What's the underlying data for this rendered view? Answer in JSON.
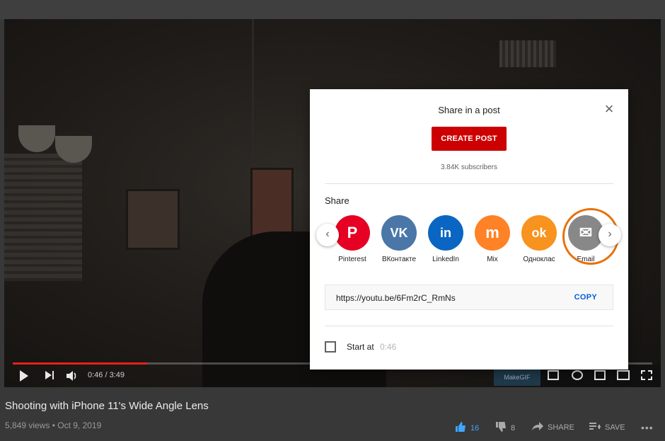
{
  "video": {
    "time": "0:46 / 3:49",
    "progress_fraction": 0.21,
    "title": "Shooting with iPhone 11's Wide Angle Lens",
    "meta": "5,849 views • Oct 9, 2019",
    "likes": "16",
    "dislikes": "8",
    "share_label": "SHARE",
    "save_label": "SAVE",
    "watermark": "MakeGIF"
  },
  "dialog": {
    "title": "Share in a post",
    "create_post": "CREATE POST",
    "subscribers": "3.84K subscribers",
    "share_heading": "Share",
    "targets": [
      {
        "name": "Pinterest",
        "color": "#e60023",
        "glyph": "P"
      },
      {
        "name": "ВКонтакте",
        "color": "#4a76a8",
        "glyph": "VK"
      },
      {
        "name": "LinkedIn",
        "color": "#0a66c2",
        "glyph": "in"
      },
      {
        "name": "Mix",
        "color": "#ff8226",
        "glyph": "m"
      },
      {
        "name": "Одноклас",
        "color": "#f7931e",
        "glyph": "ok"
      },
      {
        "name": "Email",
        "color": "#888888",
        "glyph": "✉"
      }
    ],
    "url": "https://youtu.be/6Fm2rC_RmNs",
    "copy": "COPY",
    "start_at_label": "Start at",
    "start_at_time": "0:46",
    "highlight_color": "#e8710a"
  }
}
